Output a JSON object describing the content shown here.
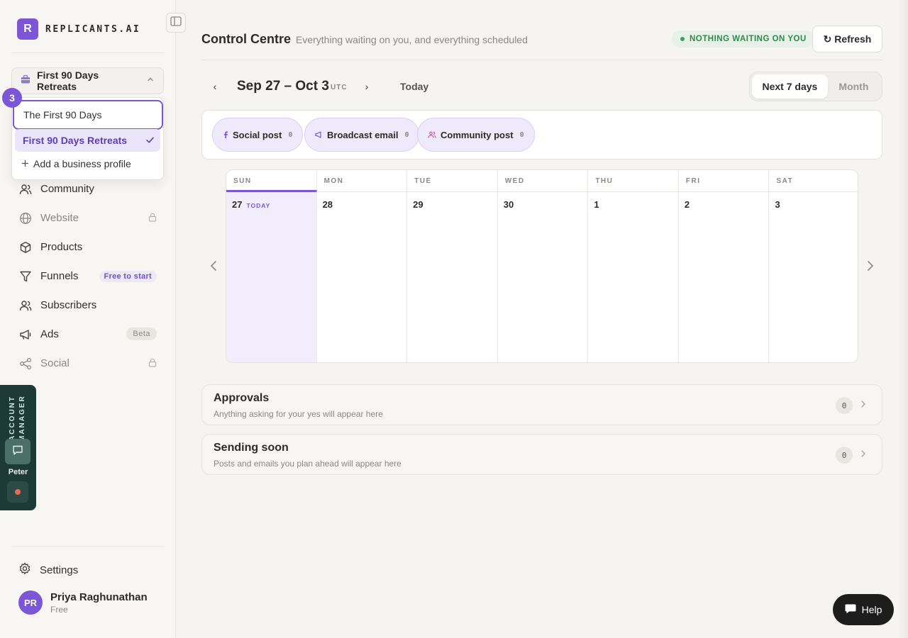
{
  "brand": {
    "logo_letter": "R",
    "name": "REPLICANTS.AI",
    "accent": "#7b56d6"
  },
  "profile_select": {
    "current": "First 90 Days Retreats"
  },
  "profile_dropdown": {
    "items": [
      {
        "label": "The First 90 Days"
      },
      {
        "label": "First 90 Days Retreats",
        "selected": true
      }
    ],
    "add_label": "Add a business profile",
    "step_badge": "3"
  },
  "sidebar": {
    "items": [
      {
        "label": "Community",
        "icon": "users-icon"
      },
      {
        "label": "Website",
        "icon": "globe-icon",
        "locked": true
      },
      {
        "label": "Products",
        "icon": "box-icon"
      },
      {
        "label": "Funnels",
        "icon": "funnel-icon",
        "badge": "Free to start"
      },
      {
        "label": "Subscribers",
        "icon": "subscribers-icon"
      },
      {
        "label": "Ads",
        "icon": "megaphone-icon",
        "badge": "Beta"
      },
      {
        "label": "Social",
        "icon": "share-icon",
        "locked": true
      }
    ],
    "settings_label": "Settings"
  },
  "account_manager": {
    "title": "ACCOUNT MANAGER",
    "name": "Peter"
  },
  "user": {
    "initials": "PR",
    "name": "Priya Raghunathan",
    "plan": "Free"
  },
  "header": {
    "title": "Control Centre",
    "subtitle": "Everything waiting on you, and everything scheduled",
    "status": "NOTHING WAITING ON YOU",
    "refresh_label": "↻ Refresh"
  },
  "datebar": {
    "prev": "‹",
    "next": "›",
    "range": "Sep 27 – Oct 3",
    "timezone": "UTC",
    "today_label": "Today",
    "views": [
      "Next 7 days",
      "Month"
    ],
    "active_view": "Next 7 days"
  },
  "filters": [
    {
      "label": "Social post",
      "count": "0",
      "icon": "facebook-icon"
    },
    {
      "label": "Broadcast email",
      "count": "0",
      "icon": "megaphone-icon"
    },
    {
      "label": "Community post",
      "count": "0",
      "icon": "users-icon"
    }
  ],
  "calendar": {
    "weekdays": [
      "SUN",
      "MON",
      "TUE",
      "WED",
      "THU",
      "FRI",
      "SAT"
    ],
    "days": [
      "27",
      "28",
      "29",
      "30",
      "1",
      "2",
      "3"
    ],
    "today_index": 0,
    "today_tag": "TODAY"
  },
  "approvals": {
    "title": "Approvals",
    "subtitle": "Anything asking for your yes will appear here",
    "count": "0"
  },
  "sending_soon": {
    "title": "Sending soon",
    "subtitle": "Posts and emails you plan ahead will appear here",
    "count": "0"
  },
  "help": {
    "label": "Help"
  }
}
